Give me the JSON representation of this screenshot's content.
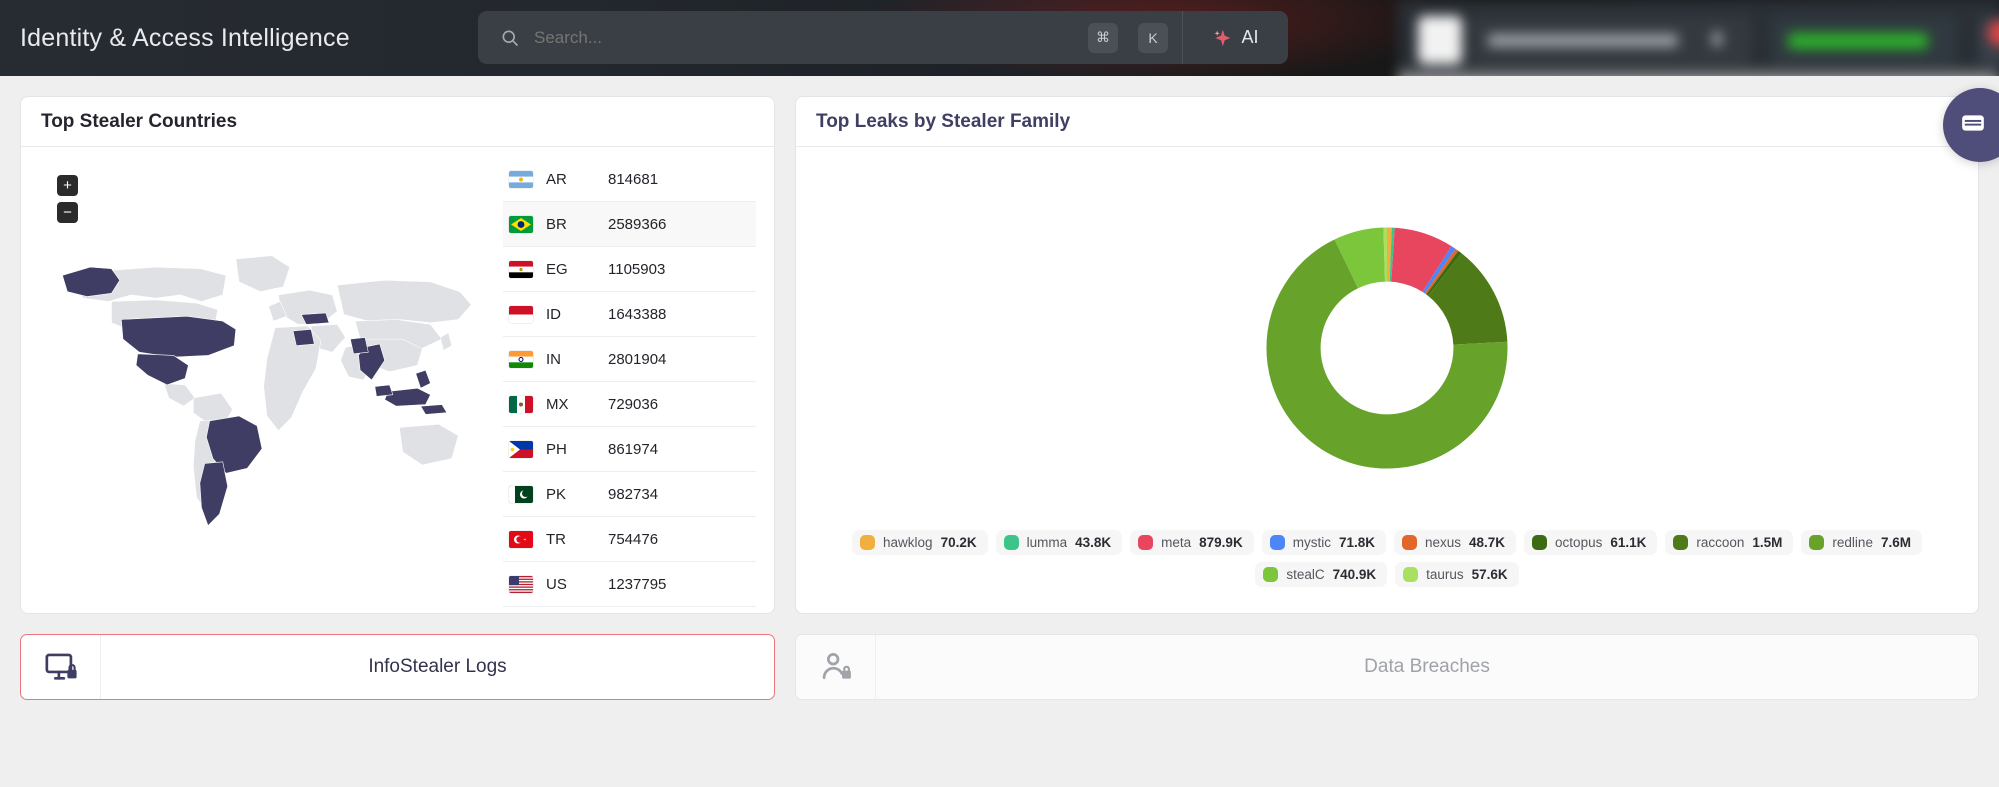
{
  "header": {
    "brand": "Identity & Access Intelligence",
    "search": {
      "placeholder": "Search...",
      "icon": "search-icon",
      "kbd_modifier": "⌘",
      "kbd_key": "K"
    },
    "ai_button": {
      "label": "AI",
      "icon": "sparkle-icon"
    }
  },
  "cards": {
    "map": {
      "title": "Top Stealer Countries",
      "zoom_in": "+",
      "zoom_out": "−",
      "highlight_color": "#3f3d63",
      "base_color": "#e0e1e4",
      "countries": [
        {
          "code": "AR",
          "value": "814681",
          "flag": "ar"
        },
        {
          "code": "BR",
          "value": "2589366",
          "flag": "br"
        },
        {
          "code": "EG",
          "value": "1105903",
          "flag": "eg"
        },
        {
          "code": "ID",
          "value": "1643388",
          "flag": "id"
        },
        {
          "code": "IN",
          "value": "2801904",
          "flag": "in"
        },
        {
          "code": "MX",
          "value": "729036",
          "flag": "mx"
        },
        {
          "code": "PH",
          "value": "861974",
          "flag": "ph"
        },
        {
          "code": "PK",
          "value": "982734",
          "flag": "pk"
        },
        {
          "code": "TR",
          "value": "754476",
          "flag": "tr"
        },
        {
          "code": "US",
          "value": "1237795",
          "flag": "us"
        }
      ]
    },
    "donut": {
      "title": "Top Leaks by Stealer Family"
    }
  },
  "chart_data": {
    "type": "pie",
    "title": "Top Leaks by Stealer Family",
    "legend_position": "bottom",
    "donut": true,
    "categories": [
      "hawklog",
      "lumma",
      "meta",
      "mystic",
      "nexus",
      "octopus",
      "raccoon",
      "redline",
      "stealC",
      "taurus"
    ],
    "labels": [
      "70.2K",
      "43.8K",
      "879.9K",
      "71.8K",
      "48.7K",
      "61.1K",
      "1.5M",
      "7.6M",
      "740.9K",
      "57.6K"
    ],
    "values": [
      70200,
      43800,
      879900,
      71800,
      48700,
      61100,
      1500000,
      7600000,
      740900,
      57600
    ],
    "colors": [
      "#efb03f",
      "#3cc48a",
      "#e8455f",
      "#4d86f7",
      "#e2662a",
      "#3d6b14",
      "#4f7a18",
      "#67a22b",
      "#7cc63c",
      "#a9e060"
    ]
  },
  "tabs": [
    {
      "label": "InfoStealer Logs",
      "icon": "monitor-lock-icon",
      "state": "active"
    },
    {
      "label": "Data Breaches",
      "icon": "person-lock-icon",
      "state": "inactive"
    }
  ],
  "chat_fab": {
    "icon": "chat-icon",
    "color": "#4f4e7a"
  }
}
